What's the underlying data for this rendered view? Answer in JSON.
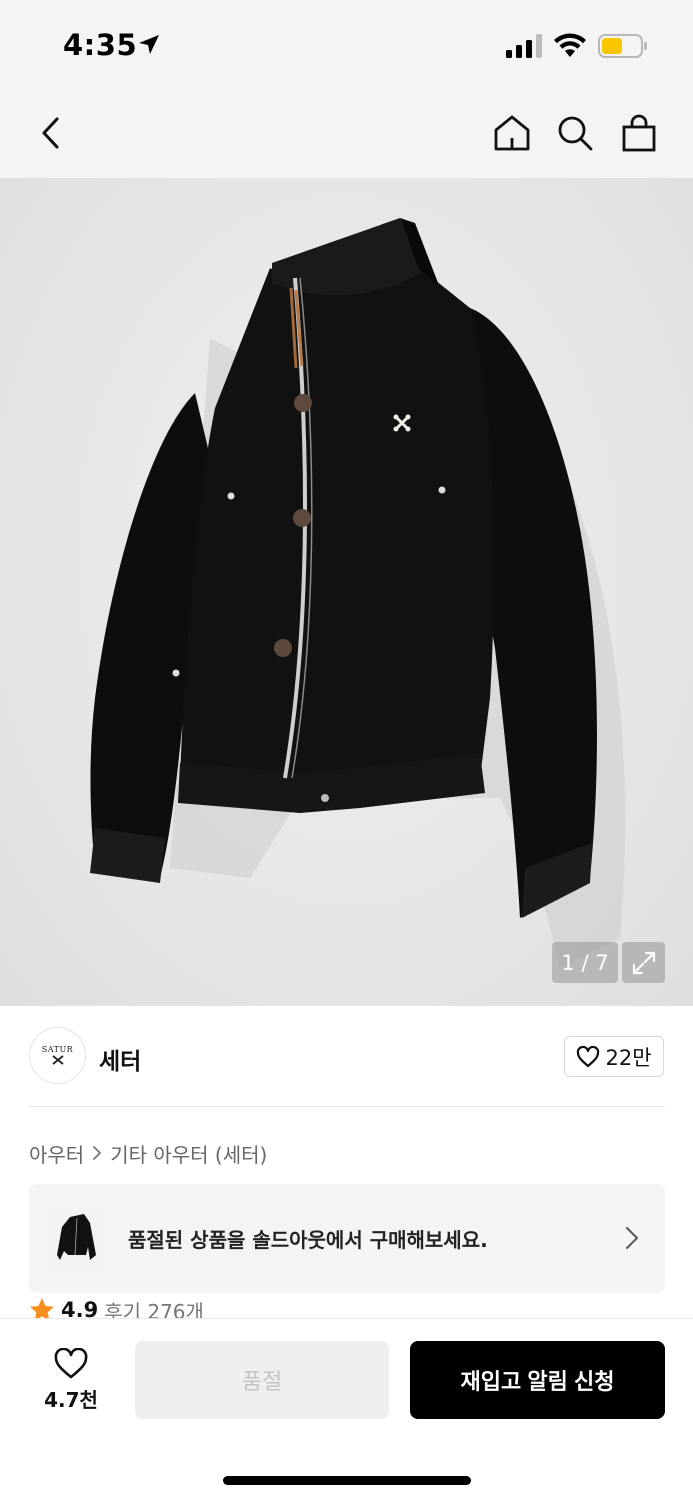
{
  "status_bar": {
    "time": "4:35"
  },
  "nav": {
    "icons": [
      "back-icon",
      "home-icon",
      "search-icon",
      "bag-icon"
    ]
  },
  "gallery": {
    "indicator": "1 / 7"
  },
  "brand": {
    "name": "세터",
    "logo_text": "SATUR",
    "like_count": "22만"
  },
  "breadcrumb": {
    "level1": "아우터",
    "level2": "기타 아우터 (세터)"
  },
  "soldout_banner": {
    "text": "품절된 상품을 솔드아웃에서 구매해보세요."
  },
  "rating": {
    "score": "4.9",
    "reviews": "후기 276개"
  },
  "bottom_bar": {
    "wish_count": "4.7천",
    "soldout_label": "품절",
    "restock_label": "재입고 알림 신청"
  },
  "colors": {
    "accent": "#000000",
    "star": "#f5901e",
    "battery": "#f7c600"
  }
}
